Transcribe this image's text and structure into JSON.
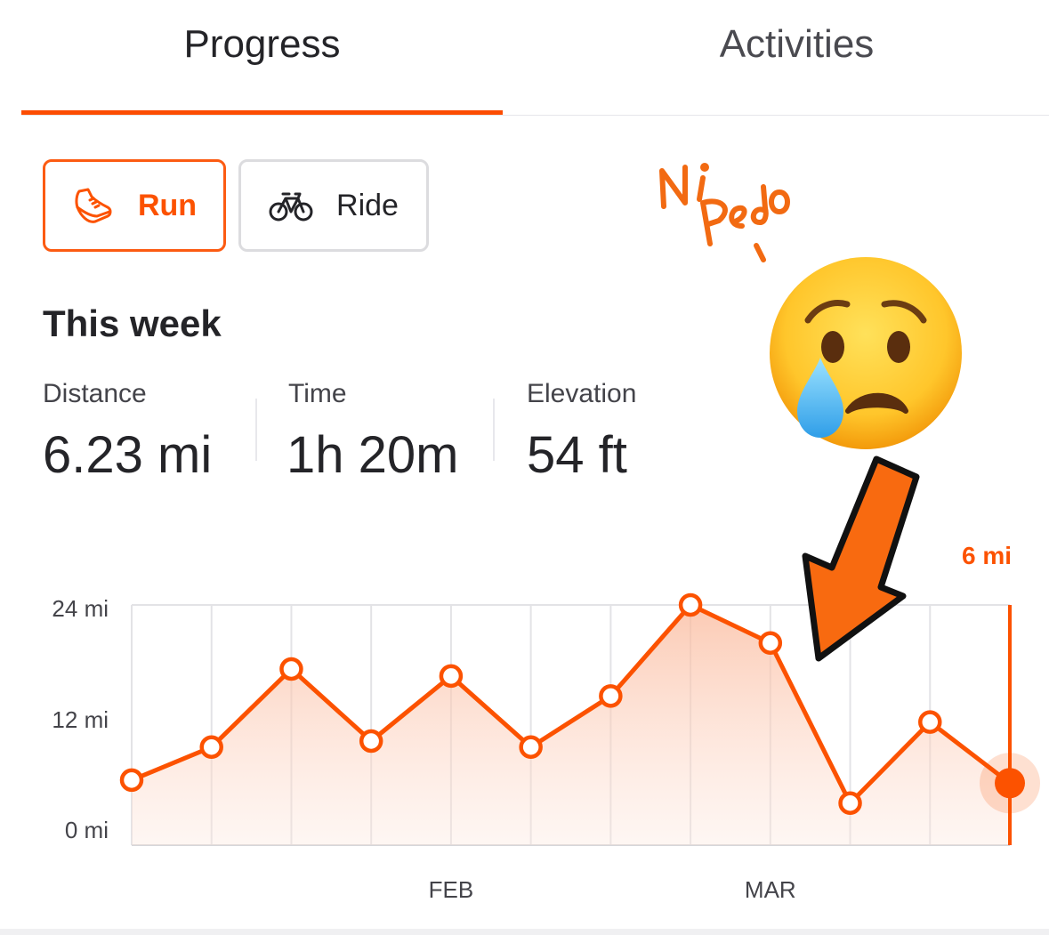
{
  "tabs": {
    "progress_label": "Progress",
    "activities_label": "Activities",
    "active": "Progress"
  },
  "sport_filter": {
    "run_label": "Run",
    "ride_label": "Ride",
    "selected": "Run",
    "run_icon": "running-shoe-icon",
    "ride_icon": "bicycle-icon"
  },
  "this_week": {
    "title": "This week",
    "stats": [
      {
        "label": "Distance",
        "value": "6.23 mi"
      },
      {
        "label": "Time",
        "value": "1h 20m"
      },
      {
        "label": "Elevation",
        "value": "54 ft"
      }
    ]
  },
  "chart_data": {
    "type": "area",
    "y_tick_labels": [
      "24 mi",
      "12 mi",
      "0 mi"
    ],
    "y_ticks": [
      24,
      12,
      0
    ],
    "ylim": [
      0,
      24
    ],
    "x_tick_labels": [
      "FEB",
      "MAR"
    ],
    "x_tick_index": [
      4,
      8
    ],
    "values": [
      6.5,
      9.8,
      17.6,
      10.4,
      16.9,
      9.8,
      14.9,
      24,
      20.2,
      4.2,
      12.3,
      6.2
    ],
    "selected_index": 11,
    "selected_label": "6 mi",
    "grid": true,
    "colors": {
      "line": "#fc5200",
      "fill_top": "#fbc4ad",
      "grid": "#e3e3e6"
    }
  },
  "annotation": {
    "text_line1": "Ni",
    "text_line2": "Pedo",
    "emoji": "crying-face-emoji",
    "arrow": "orange-arrow-pointing-to-drop"
  },
  "colors": {
    "accent": "#fc4c02",
    "text": "#242428",
    "muted": "#44444a"
  }
}
